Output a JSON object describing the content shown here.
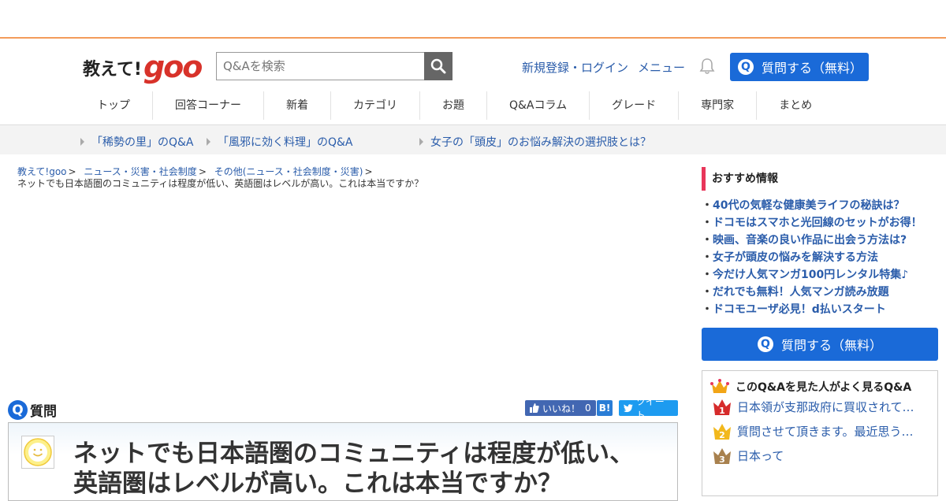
{
  "header": {
    "logo_text": "教えて!",
    "logo_brand": "goo",
    "search_placeholder": "Q&Aを検索",
    "register_login": "新規登録・ログイン",
    "menu": "メニュー",
    "ask_button": "質問する（無料）",
    "q_letter": "Q"
  },
  "nav": [
    "トップ",
    "回答コーナー",
    "新着",
    "カテゴリ",
    "お題",
    "Q&Aコラム",
    "グレード",
    "専門家",
    "まとめ"
  ],
  "promo": [
    "「稀勢の里」のQ&A",
    "「風邪に効く料理」のQ&A",
    "女子の「頭皮」のお悩み解決の選択肢とは？"
  ],
  "breadcrumb": {
    "items": [
      "教えて!goo",
      "ニュース・災害・社会制度",
      "その他(ニュース・社会制度・災害)"
    ],
    "current": "ネットでも日本語圏のコミュニティは程度が低い、英語圏はレベルが高い。これは本当ですか？"
  },
  "question": {
    "label": "質問",
    "title": "ネットでも日本語圏のコミュニティは程度が低い、英語圏はレベルが高い。これは本当ですか？",
    "like_label": "いいね！",
    "like_count": "0",
    "hatena": "B!",
    "tweet": "ツイート"
  },
  "sidebar": {
    "recommend_title": "おすすめ情報",
    "recommend_items": [
      "40代の気軽な健康美ライフの秘訣は？",
      "ドコモはスマホと光回線のセットがお得！",
      "映画、音楽の良い作品に出会う方法は?",
      "女子が頭皮の悩みを解決する方法",
      "今だけ人気マンガ100円レンタル特集♪",
      "だれでも無料！人気マンガ読み放題",
      "ドコモユーザ必見！d払いスタート"
    ],
    "ask_button": "質問する（無料）",
    "ranking_title": "このQ&Aを見た人がよく見るQ&A",
    "ranking": [
      {
        "rank": "1",
        "text": "日本領が支那政府に買収されて…"
      },
      {
        "rank": "2",
        "text": "質問させて頂きます。最近思う…"
      },
      {
        "rank": "3",
        "text": "日本って"
      }
    ]
  },
  "colors": {
    "accent_blue": "#1a6ad8",
    "link_blue": "#2a5caa",
    "goo_red": "#d8322a",
    "topbar_orange": "#f39c5a",
    "recommend_bar": "#e8365a"
  }
}
